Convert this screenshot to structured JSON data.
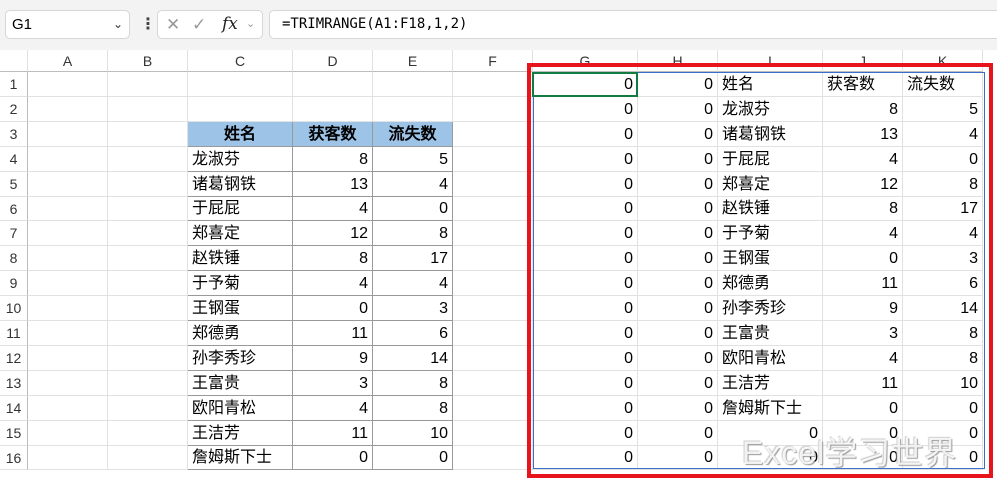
{
  "name_box": {
    "value": "G1"
  },
  "formula_bar": {
    "value": "=TRIMRANGE(A1:F18,1,2)",
    "cancel_icon": "x-icon",
    "enter_icon": "check-icon",
    "fx_label": "fx"
  },
  "columns": [
    "A",
    "B",
    "C",
    "D",
    "E",
    "F",
    "G",
    "H",
    "I",
    "J",
    "K"
  ],
  "rows": [
    "1",
    "2",
    "3",
    "4",
    "5",
    "6",
    "7",
    "8",
    "9",
    "10",
    "11",
    "12",
    "13",
    "14",
    "15",
    "16"
  ],
  "source_table": {
    "headers": [
      "姓名",
      "获客数",
      "流失数"
    ],
    "rows": [
      [
        "龙淑芬",
        8,
        5
      ],
      [
        "诸葛钢铁",
        13,
        4
      ],
      [
        "于屁屁",
        4,
        0
      ],
      [
        "郑喜定",
        12,
        8
      ],
      [
        "赵铁锤",
        8,
        17
      ],
      [
        "于予菊",
        4,
        4
      ],
      [
        "王钢蛋",
        0,
        3
      ],
      [
        "郑德勇",
        11,
        6
      ],
      [
        "孙李秀珍",
        9,
        14
      ],
      [
        "王富贵",
        3,
        8
      ],
      [
        "欧阳青松",
        4,
        8
      ],
      [
        "王洁芳",
        11,
        10
      ],
      [
        "詹姆斯下士",
        0,
        0
      ]
    ]
  },
  "spill_result": {
    "rows": [
      [
        0,
        0,
        "姓名",
        "获客数",
        "流失数"
      ],
      [
        0,
        0,
        "龙淑芬",
        8,
        5
      ],
      [
        0,
        0,
        "诸葛钢铁",
        13,
        4
      ],
      [
        0,
        0,
        "于屁屁",
        4,
        0
      ],
      [
        0,
        0,
        "郑喜定",
        12,
        8
      ],
      [
        0,
        0,
        "赵铁锤",
        8,
        17
      ],
      [
        0,
        0,
        "于予菊",
        4,
        4
      ],
      [
        0,
        0,
        "王钢蛋",
        0,
        3
      ],
      [
        0,
        0,
        "郑德勇",
        11,
        6
      ],
      [
        0,
        0,
        "孙李秀珍",
        9,
        14
      ],
      [
        0,
        0,
        "王富贵",
        3,
        8
      ],
      [
        0,
        0,
        "欧阳青松",
        4,
        8
      ],
      [
        0,
        0,
        "王洁芳",
        11,
        10
      ],
      [
        0,
        0,
        "詹姆斯下士",
        0,
        0
      ],
      [
        0,
        0,
        0,
        0,
        0
      ],
      [
        0,
        0,
        0,
        0,
        0
      ]
    ]
  },
  "watermark": "Excel学习世界",
  "colors": {
    "header_fill": "#9dc3e6",
    "highlight_box": "#e8141c",
    "spill_border": "#3a6fc9",
    "active_cell": "#107c41"
  }
}
